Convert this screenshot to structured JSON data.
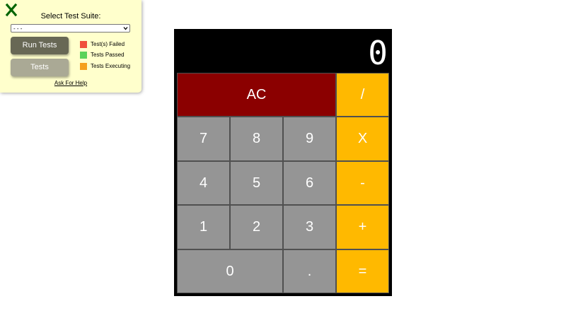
{
  "test_panel": {
    "title": "Select Test Suite:",
    "close_icon": "close-x-icon",
    "suite_select": {
      "selected": "- - -"
    },
    "run_button": "Run Tests",
    "tests_button": "Tests",
    "legend": [
      {
        "label": "Test(s) Failed",
        "color": "#f0503c"
      },
      {
        "label": "Tests Passed",
        "color": "#5ad25a"
      },
      {
        "label": "Tests Executing",
        "color": "#f5a01e"
      }
    ],
    "help_link": "Ask For Help",
    "colors": {
      "close_icon": "#006400",
      "panel_bg": "#ffffcc"
    }
  },
  "calculator": {
    "display": "0",
    "keys": {
      "clear": "AC",
      "divide": "/",
      "multiply": "X",
      "subtract": "-",
      "add": "+",
      "equals": "=",
      "seven": "7",
      "eight": "8",
      "nine": "9",
      "four": "4",
      "five": "5",
      "six": "6",
      "one": "1",
      "two": "2",
      "three": "3",
      "zero": "0",
      "decimal": "."
    },
    "colors": {
      "number_key": "#959595",
      "operator_key": "#ffb900",
      "clear_key": "#8b0000",
      "display_bg": "#000000"
    }
  }
}
